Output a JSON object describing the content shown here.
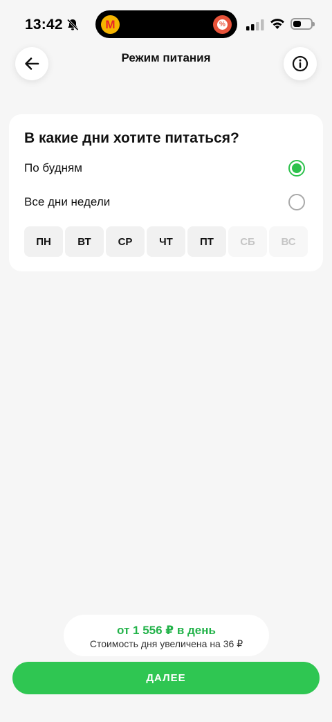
{
  "status_bar": {
    "time": "13:42",
    "island_app_letter": "M",
    "island_promo_symbol": "%",
    "battery_level_fraction": 0.45
  },
  "header": {
    "title": "Режим питания",
    "back_icon": "arrow-left-icon",
    "info_icon": "info-icon"
  },
  "card": {
    "question": "В какие дни хотите питаться?",
    "options": [
      {
        "label": "По будням",
        "selected": true
      },
      {
        "label": "Все дни недели",
        "selected": false
      }
    ],
    "days": [
      {
        "label": "ПН",
        "active": true
      },
      {
        "label": "ВТ",
        "active": true
      },
      {
        "label": "СР",
        "active": true
      },
      {
        "label": "ЧТ",
        "active": true
      },
      {
        "label": "ПТ",
        "active": true
      },
      {
        "label": "СБ",
        "active": false
      },
      {
        "label": "ВС",
        "active": false
      }
    ]
  },
  "footer": {
    "price": "от 1 556 ₽ в день",
    "price_note": "Стоимость дня увеличена на 36 ₽",
    "next_label": "ДАЛЕЕ"
  },
  "colors": {
    "accent": "#2fc652",
    "price_text": "#23b34a",
    "background": "#f6f6f6"
  }
}
